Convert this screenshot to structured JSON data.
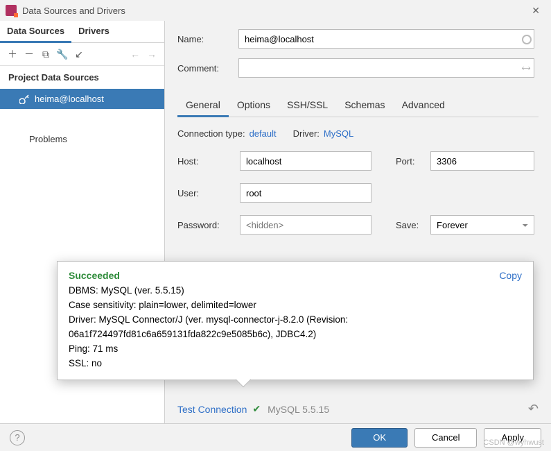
{
  "window": {
    "title": "Data Sources and Drivers"
  },
  "sidebar": {
    "tabs": [
      "Data Sources",
      "Drivers"
    ],
    "sections": {
      "project": "Project Data Sources",
      "items": [
        {
          "label": "heima@localhost"
        }
      ],
      "problems": "Problems"
    }
  },
  "form": {
    "name_label": "Name:",
    "name_value": "heima@localhost",
    "comment_label": "Comment:"
  },
  "configTabs": [
    "General",
    "Options",
    "SSH/SSL",
    "Schemas",
    "Advanced"
  ],
  "general": {
    "conn_type_label": "Connection type:",
    "conn_type_value": "default",
    "driver_label": "Driver:",
    "driver_value": "MySQL",
    "host_label": "Host:",
    "host_value": "localhost",
    "port_label": "Port:",
    "port_value": "3306",
    "user_label": "User:",
    "user_value": "root",
    "password_label": "Password:",
    "password_placeholder": "<hidden>",
    "save_label": "Save:",
    "save_value": "Forever"
  },
  "popup": {
    "title": "Succeeded",
    "copy": "Copy",
    "line1": "DBMS: MySQL (ver. 5.5.15)",
    "line2": "Case sensitivity: plain=lower, delimited=lower",
    "line3": "Driver: MySQL Connector/J (ver. mysql-connector-j-8.2.0 (Revision: 06a1f724497fd81c6a659131fda822c9e5085b6c), JDBC4.2)",
    "line4": "Ping: 71 ms",
    "line5": "SSL: no"
  },
  "testRow": {
    "link": "Test Connection",
    "version": "MySQL 5.5.15"
  },
  "footer": {
    "ok": "OK",
    "cancel": "Cancel",
    "apply": "Apply"
  },
  "watermark": "CSDN @wyhwust"
}
